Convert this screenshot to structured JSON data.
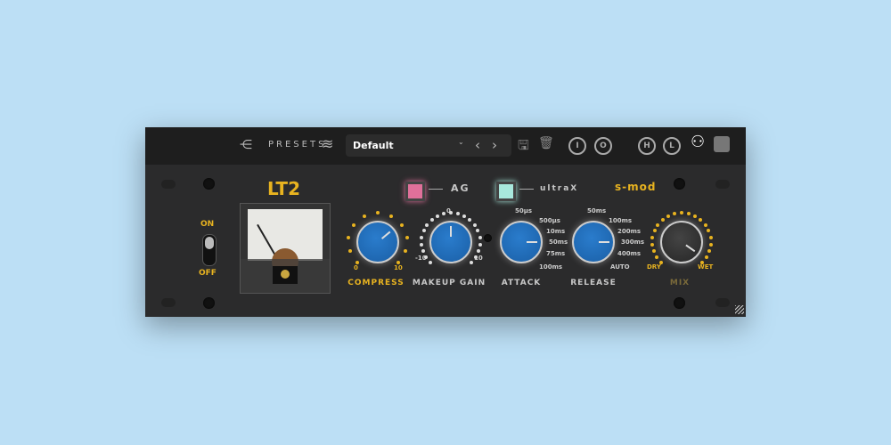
{
  "topbar": {
    "presets_label": "PRESETS",
    "preset_name": "Default",
    "buttons": [
      "I",
      "O",
      "H",
      "L"
    ]
  },
  "panel": {
    "title": "LT2",
    "brand": "s-mod",
    "power": {
      "on": "ON",
      "off": "OFF"
    },
    "ag_label": "AG",
    "ultrax_label": "ultraX",
    "knobs": {
      "compress": {
        "label": "COMPRESS",
        "min": "0",
        "max": "10"
      },
      "makeup": {
        "label": "MAKEUP GAIN",
        "min": "-10",
        "mid": "0",
        "max": "10"
      },
      "attack": {
        "label": "ATTACK",
        "steps": [
          "50µs",
          "500µs",
          "10ms",
          "50ms",
          "75ms",
          "100ms"
        ]
      },
      "release": {
        "label": "RELEASE",
        "steps": [
          "50ms",
          "100ms",
          "200ms",
          "300ms",
          "400ms",
          "AUTO"
        ]
      },
      "mix": {
        "label": "MIX",
        "min": "DRY",
        "max": "WET"
      }
    }
  },
  "colors": {
    "accent": "#e8b320",
    "knob": "#1f6bb5",
    "ag_led": "#e0709a",
    "ultrax_led": "#a8e8dc"
  }
}
